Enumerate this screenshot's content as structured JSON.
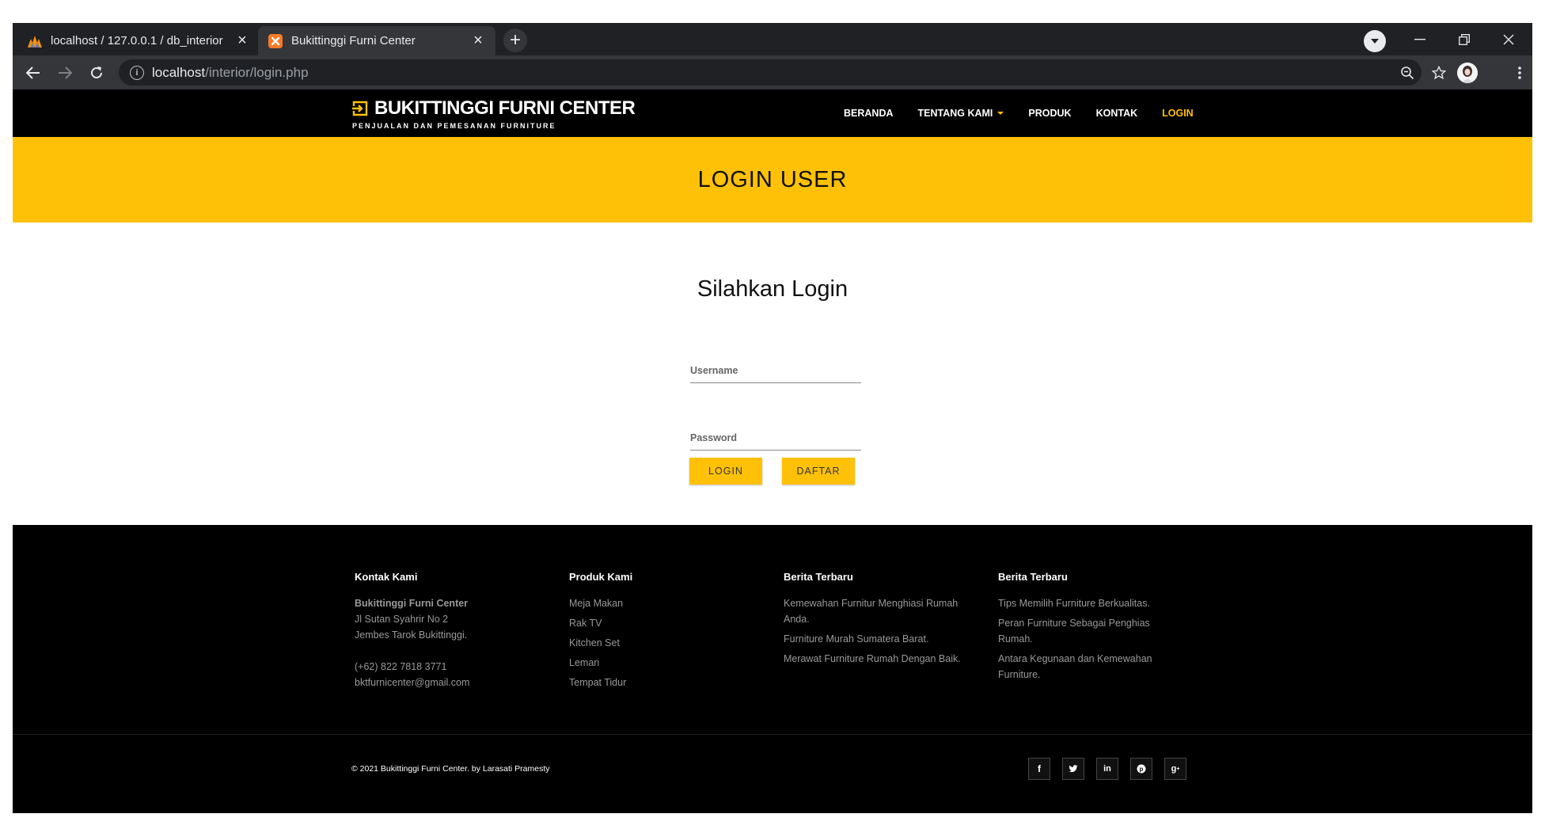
{
  "browser": {
    "tabs": [
      {
        "title": "localhost / 127.0.0.1 / db_interior",
        "icon": "phpmyadmin-icon",
        "active": false
      },
      {
        "title": "Bukittinggi Furni Center",
        "icon": "xampp-icon",
        "active": true
      }
    ],
    "url_host": "localhost",
    "url_path": "/interior/login.php"
  },
  "site": {
    "brand": "BUKITTINGGI FURNI CENTER",
    "tagline": "PENJUALAN DAN PEMESANAN FURNITURE",
    "nav": [
      {
        "label": "BERANDA",
        "active": false,
        "dropdown": false
      },
      {
        "label": "TENTANG KAMI",
        "active": false,
        "dropdown": true
      },
      {
        "label": "PRODUK",
        "active": false,
        "dropdown": false
      },
      {
        "label": "KONTAK",
        "active": false,
        "dropdown": false
      },
      {
        "label": "LOGIN",
        "active": true,
        "dropdown": false
      }
    ],
    "accent_color": "#ffc107"
  },
  "banner": {
    "title": "LOGIN USER"
  },
  "login": {
    "heading": "Silahkan Login",
    "username_placeholder": "Username",
    "password_placeholder": "Password",
    "login_button": "LOGIN",
    "register_button": "DAFTAR"
  },
  "footer": {
    "contact": {
      "title": "Kontak Kami",
      "company": "Bukittinggi Furni Center",
      "address1": "Jl Sutan Syahrir No 2",
      "address2": "Jembes Tarok Bukittinggi.",
      "phone": "(+62) 822 7818 3771",
      "email": "bktfurnicenter@gmail.com"
    },
    "products": {
      "title": "Produk Kami",
      "items": [
        "Meja Makan",
        "Rak TV",
        "Kitchen Set",
        "Lemari",
        "Tempat Tidur"
      ]
    },
    "news1": {
      "title": "Berita Terbaru",
      "items": [
        "Kemewahan Furnitur Menghiasi Rumah Anda.",
        "Furniture Murah Sumatera Barat.",
        "Merawat Furniture Rumah Dengan Baik."
      ]
    },
    "news2": {
      "title": "Berita Terbaru",
      "items": [
        "Tips Memilih Furniture Berkualitas.",
        "Peran Furniture Sebagai Penghias Rumah.",
        "Antara Kegunaan dan Kemewahan Furniture."
      ]
    },
    "copyright": "© 2021 Bukittinggi Furni Center. by Larasati Pramesty",
    "social": [
      {
        "icon": "facebook-icon",
        "glyph": "f"
      },
      {
        "icon": "twitter-icon",
        "glyph": "t"
      },
      {
        "icon": "linkedin-icon",
        "glyph": "in"
      },
      {
        "icon": "pinterest-icon",
        "glyph": "p"
      },
      {
        "icon": "google-plus-icon",
        "glyph": "g+"
      }
    ]
  }
}
